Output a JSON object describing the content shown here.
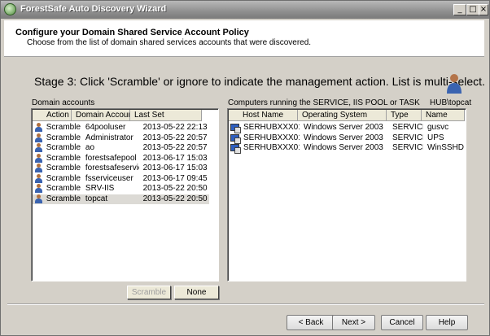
{
  "window": {
    "title": "ForestSafe Auto Discovery Wizard"
  },
  "header": {
    "title": "Configure your Domain Shared Service Account Policy",
    "subtitle": "Choose from the list of domain shared services accounts that were discovered."
  },
  "stage_text": "Stage 3: Click 'Scramble' or ignore to indicate the management action. List is multi-select.",
  "domain_accounts": {
    "label": "Domain accounts",
    "columns": [
      "Action",
      "Domain Account",
      "Last Set"
    ],
    "rows": [
      {
        "action": "Scramble",
        "account": "64pooluser",
        "last_set": "2013-05-22 22:13"
      },
      {
        "action": "Scramble",
        "account": "Administrator",
        "last_set": "2013-05-22 20:57"
      },
      {
        "action": "Scramble",
        "account": "ao",
        "last_set": "2013-05-22 20:57"
      },
      {
        "action": "Scramble",
        "account": "forestsafepool",
        "last_set": "2013-06-17 15:03"
      },
      {
        "action": "Scramble",
        "account": "forestsafeservice",
        "last_set": "2013-06-17 15:03"
      },
      {
        "action": "Scramble",
        "account": "fsserviceuser",
        "last_set": "2013-06-17 09:45"
      },
      {
        "action": "Scramble",
        "account": "SRV-IIS",
        "last_set": "2013-05-22 20:50"
      },
      {
        "action": "Scramble",
        "account": "topcat",
        "last_set": "2013-05-22 20:50"
      }
    ],
    "scramble_label": "Scramble",
    "none_label": "None"
  },
  "computers": {
    "label": "Computers running the SERVICE, IIS POOL or TASK",
    "account_label": "HUB\\topcat",
    "columns": [
      "Host Name",
      "Operating System",
      "Type",
      "Name"
    ],
    "rows": [
      {
        "host": "SERHUBXXX01",
        "os": "Windows Server 2003",
        "type": "SERVICE",
        "name": "gusvc"
      },
      {
        "host": "SERHUBXXX01",
        "os": "Windows Server 2003",
        "type": "SERVICE",
        "name": "UPS"
      },
      {
        "host": "SERHUBXXX01",
        "os": "Windows Server 2003",
        "type": "SERVICE",
        "name": "WinSSHD"
      }
    ]
  },
  "footer": {
    "back_label": "< Back",
    "next_label": "Next >",
    "cancel_label": "Cancel",
    "help_label": "Help"
  }
}
